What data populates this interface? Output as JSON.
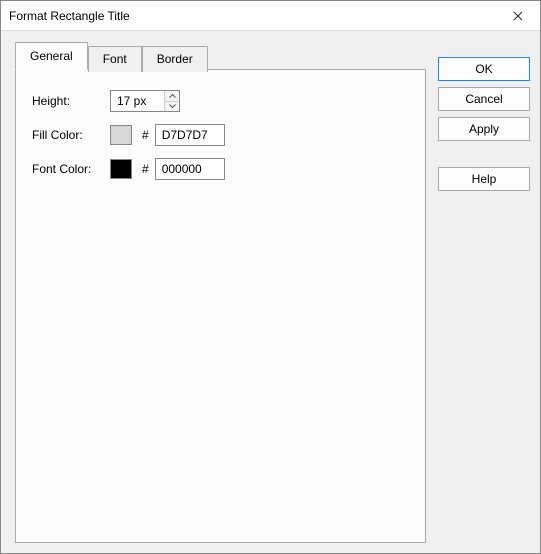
{
  "window": {
    "title": "Format Rectangle Title"
  },
  "tabs": {
    "general": "General",
    "font": "Font",
    "border": "Border",
    "active": "general"
  },
  "general": {
    "height_label": "Height:",
    "height_value": "17 px",
    "fill_label": "Fill Color:",
    "fill_hash": "#",
    "fill_hex": "D7D7D7",
    "fill_swatch": "#D7D7D7",
    "font_label": "Font Color:",
    "font_hash": "#",
    "font_hex": "000000",
    "font_swatch": "#000000"
  },
  "buttons": {
    "ok": "OK",
    "cancel": "Cancel",
    "apply": "Apply",
    "help": "Help"
  }
}
